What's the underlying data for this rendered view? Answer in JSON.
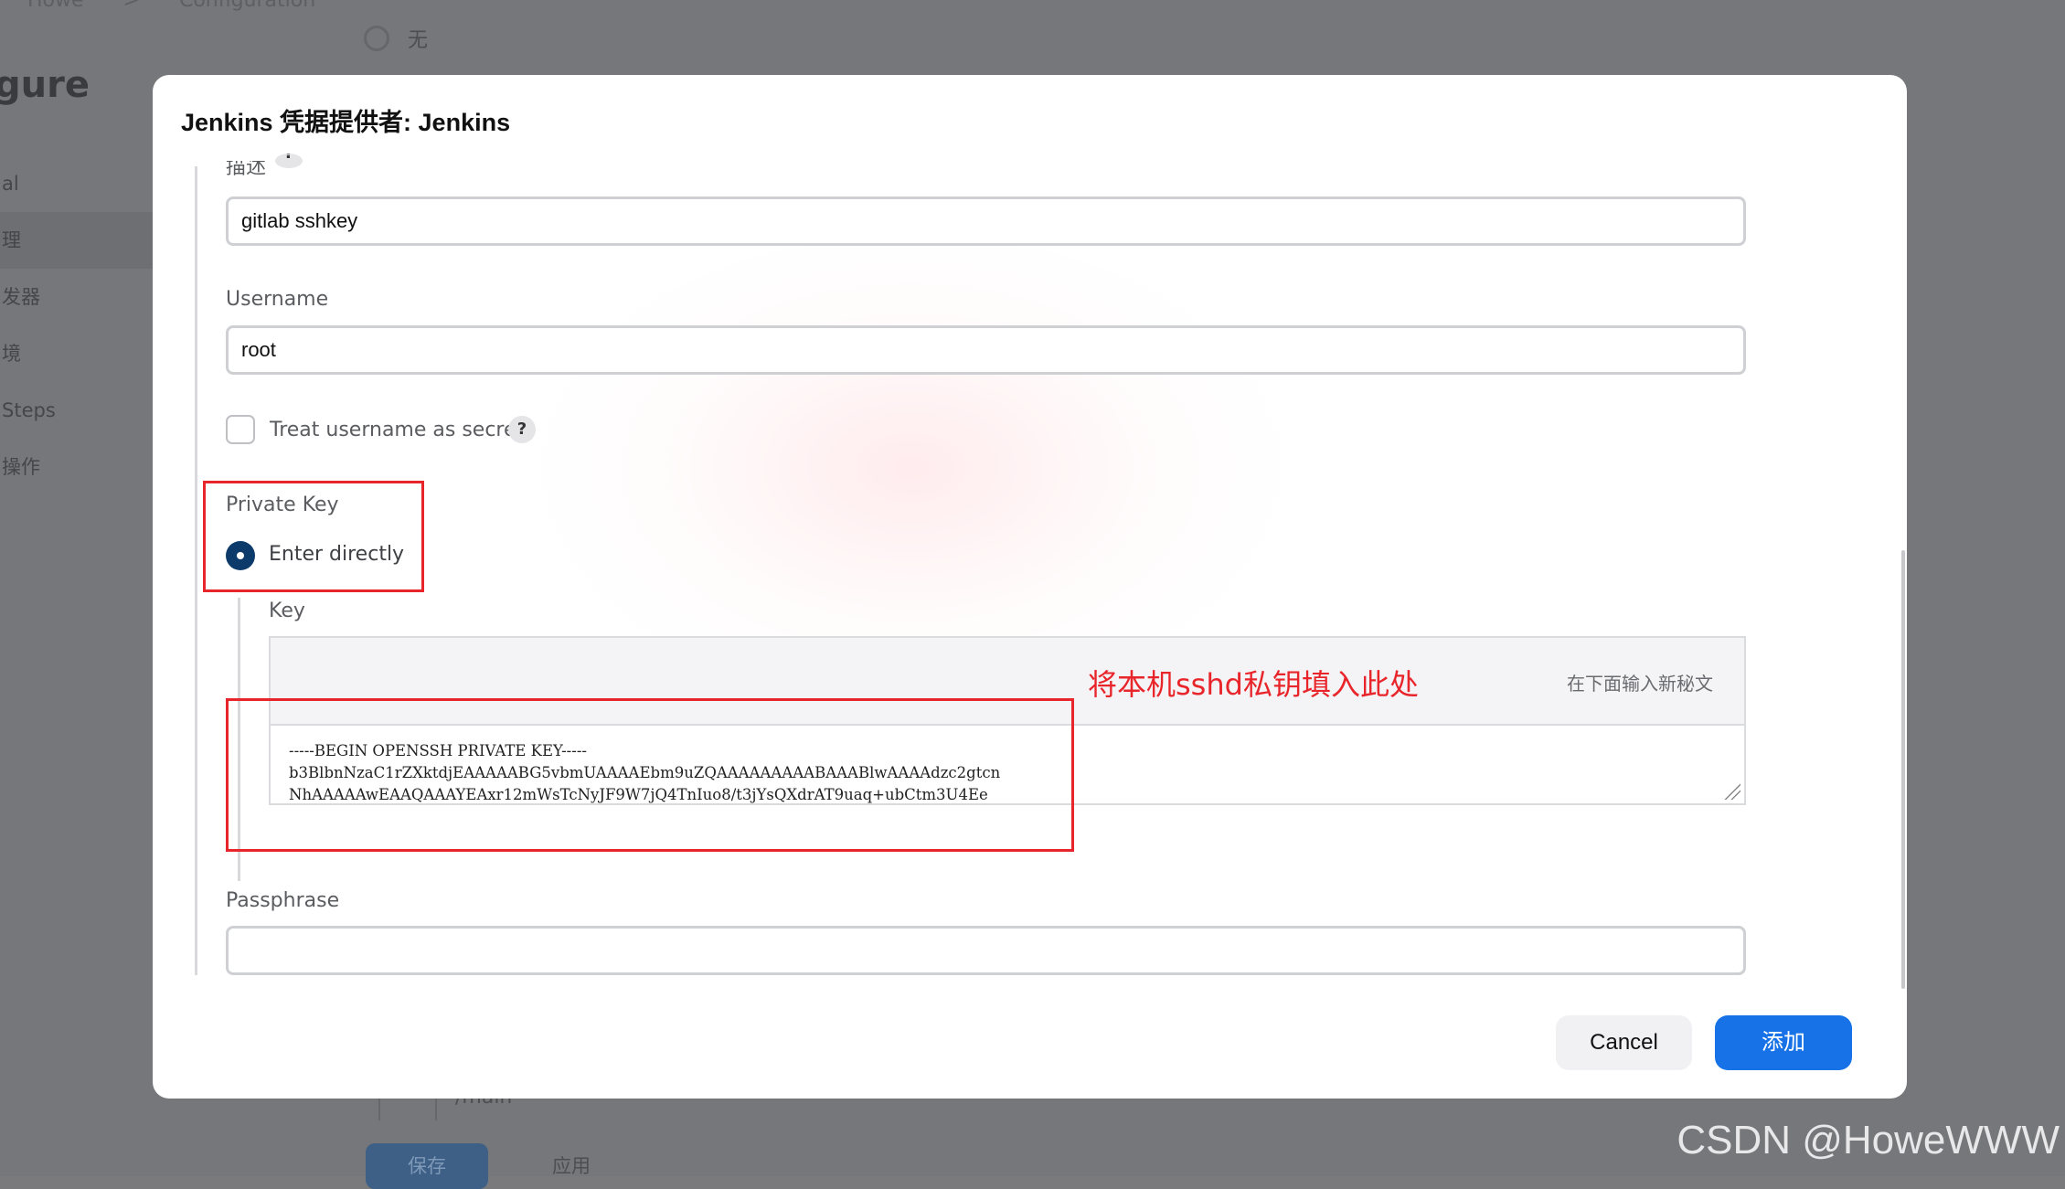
{
  "background": {
    "breadcrumb": [
      "Howe",
      ">",
      "Configuration"
    ],
    "page_title": "gure",
    "nav_items": [
      "al",
      "理",
      "发器",
      "境",
      "Steps",
      "操作"
    ],
    "radio_none_label": "无",
    "branch_value": "/main",
    "save_label": "保存",
    "apply_label": "应用"
  },
  "modal": {
    "title": "Jenkins 凭据提供者: Jenkins",
    "description": {
      "label": "描述",
      "help": "?",
      "value": "gitlab sshkey"
    },
    "username": {
      "label": "Username",
      "value": "root"
    },
    "treat_username_secret": {
      "label": "Treat username as secret",
      "help": "?",
      "checked": false
    },
    "private_key": {
      "label": "Private Key",
      "option_label": "Enter directly",
      "selected": true,
      "key_label": "Key",
      "key_hint": "在下面输入新秘文",
      "key_lines": [
        "-----BEGIN OPENSSH PRIVATE KEY-----",
        "b3BlbnNzaC1rZXktdjEAAAAABG5vbmUAAAAEbm9uZQAAAAAAAAABAAABlwAAAAdzc2gtcn",
        "NhAAAAAwEAAQAAAYEAxr12mWsTcNyJF9W7jQ4TnIuo8/t3jYsQXdrAT9uaq+ubCtm3U4Ee"
      ]
    },
    "annotation": "将本机sshd私钥填入此处",
    "passphrase": {
      "label": "Passphrase",
      "value": ""
    },
    "cancel_label": "Cancel",
    "add_label": "添加"
  },
  "watermark": "CSDN @HoweWWW",
  "colors": {
    "primary": "#1672e6",
    "radio": "#0c3b6b",
    "annotation_red": "#e8252a"
  }
}
